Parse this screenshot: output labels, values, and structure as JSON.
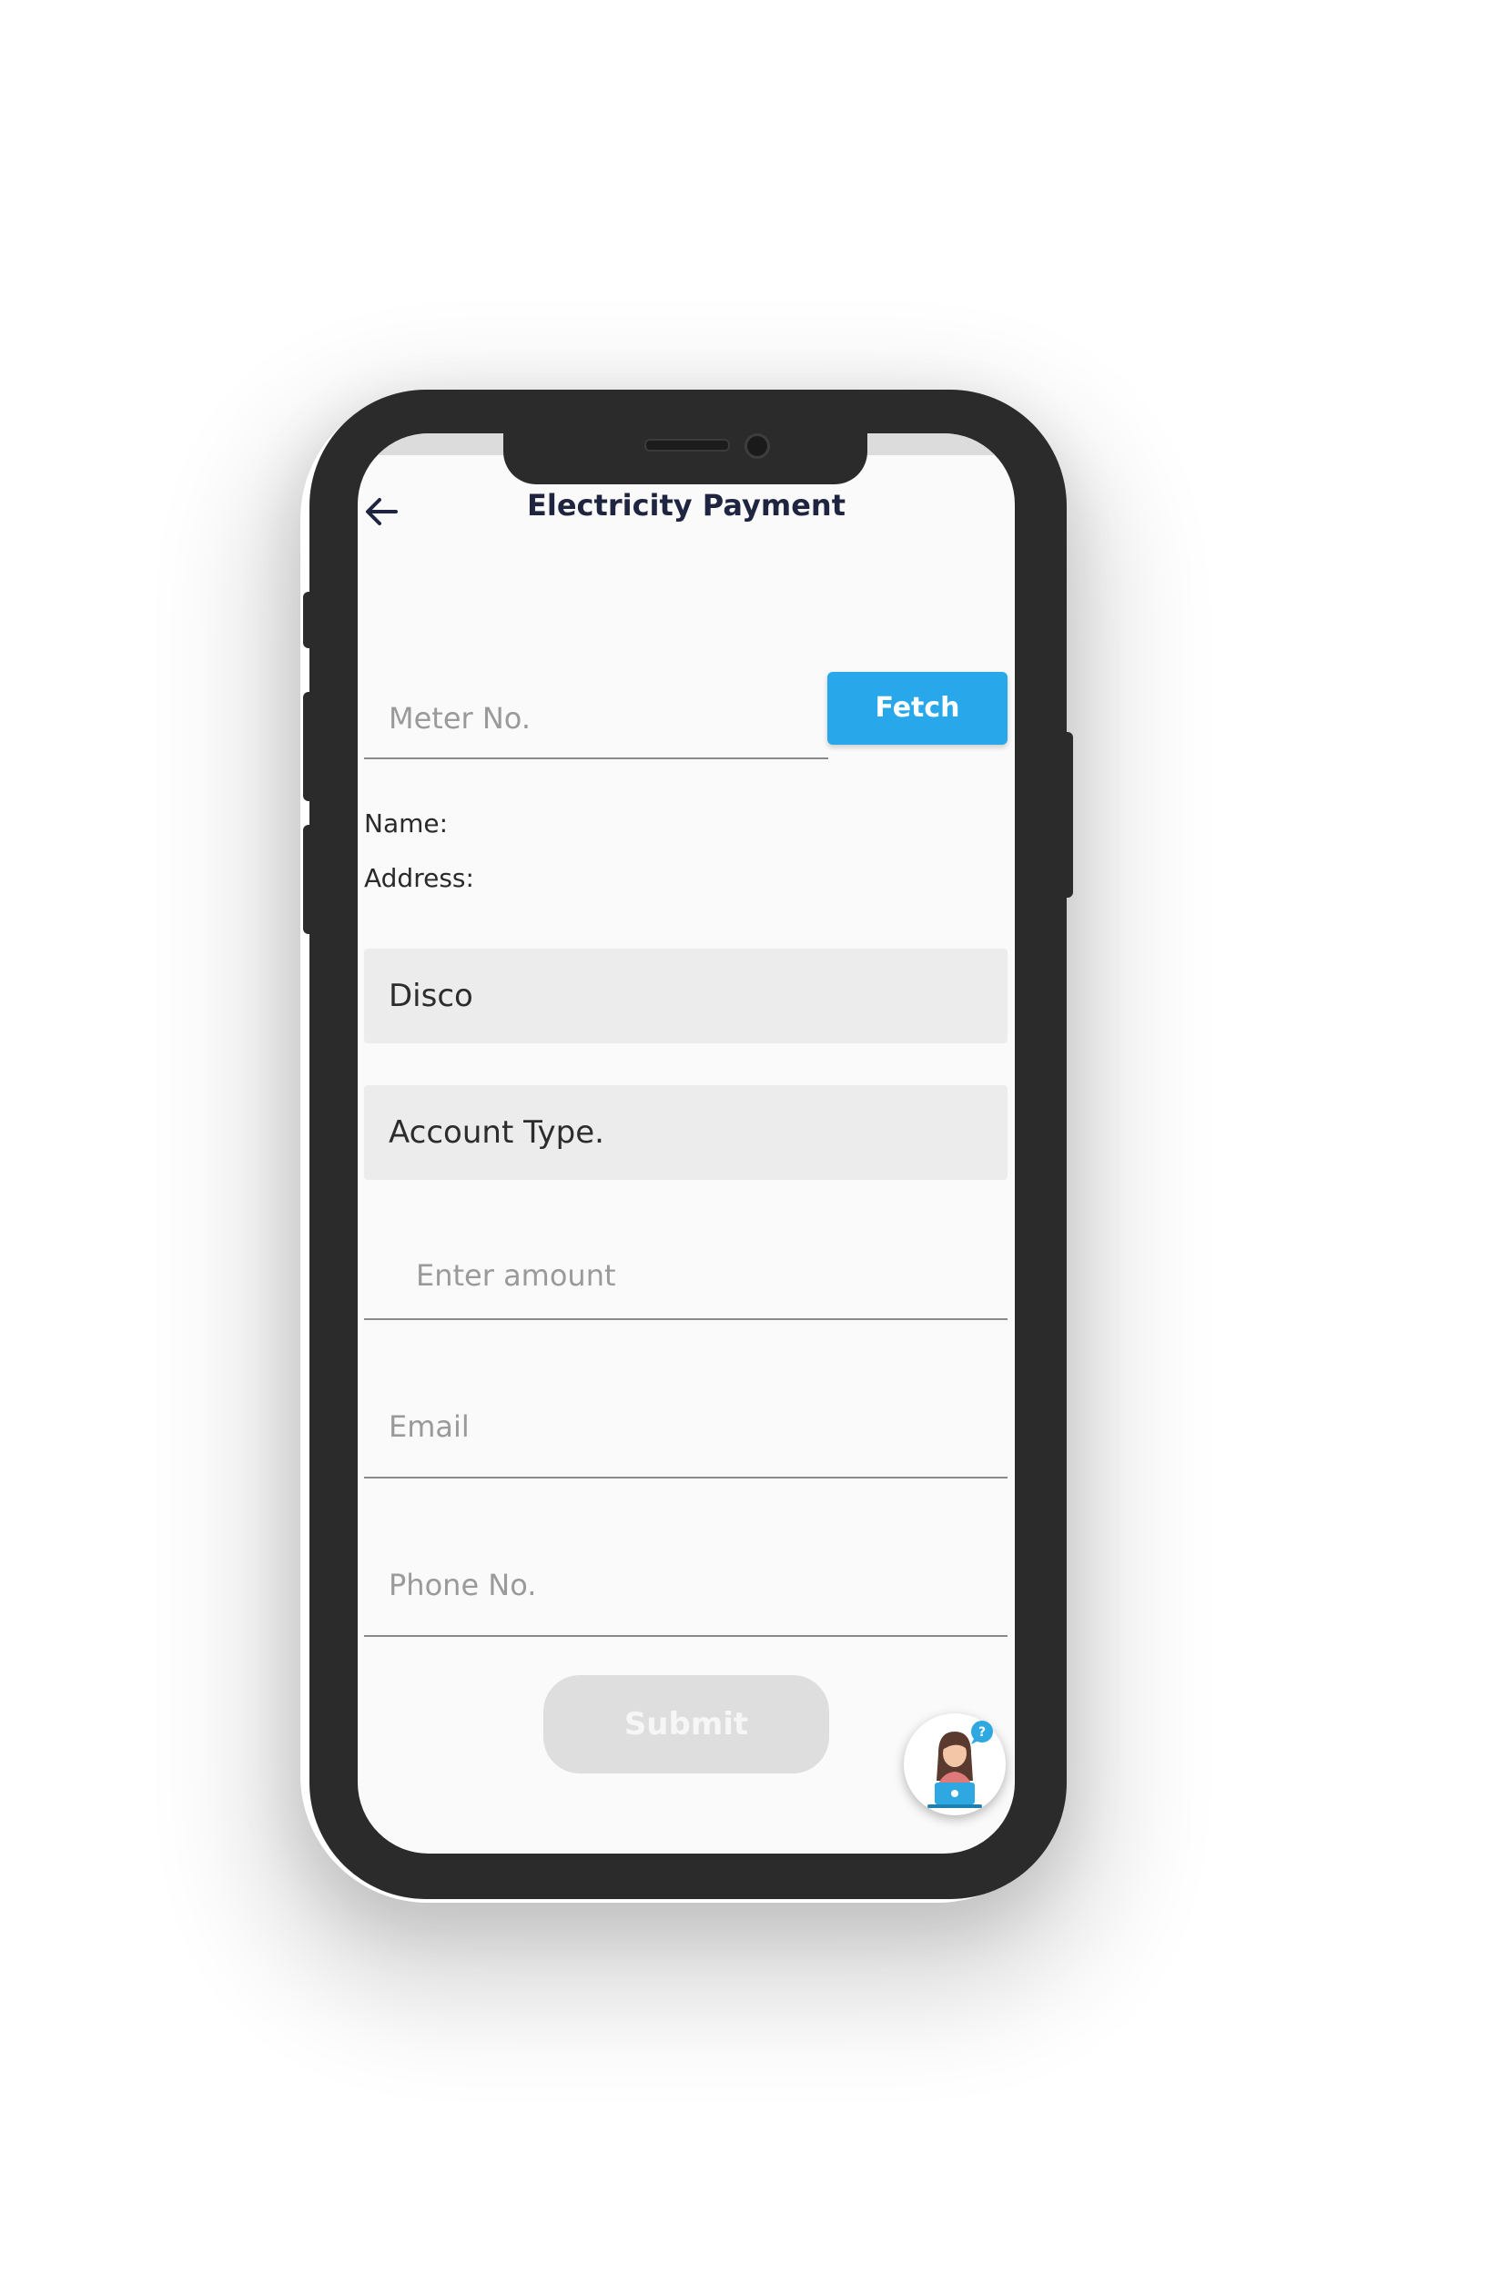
{
  "header": {
    "title": "Electricity Payment",
    "back_icon": "back-arrow-icon"
  },
  "meter": {
    "placeholder": "Meter No.",
    "fetch_label": "Fetch"
  },
  "customer": {
    "name_label": "Name:",
    "address_label": "Address:"
  },
  "selects": {
    "disco": "Disco",
    "account_type": "Account Type."
  },
  "fields": {
    "amount_placeholder": "Enter amount",
    "email_placeholder": "Email",
    "phone_placeholder": "Phone No."
  },
  "actions": {
    "submit_label": "Submit"
  },
  "support": {
    "icon": "customer-support-agent-icon"
  },
  "colors": {
    "accent": "#28a7ea",
    "title": "#1f2540",
    "phone_frame": "#2b2b2b",
    "disabled_button": "#dedede"
  }
}
